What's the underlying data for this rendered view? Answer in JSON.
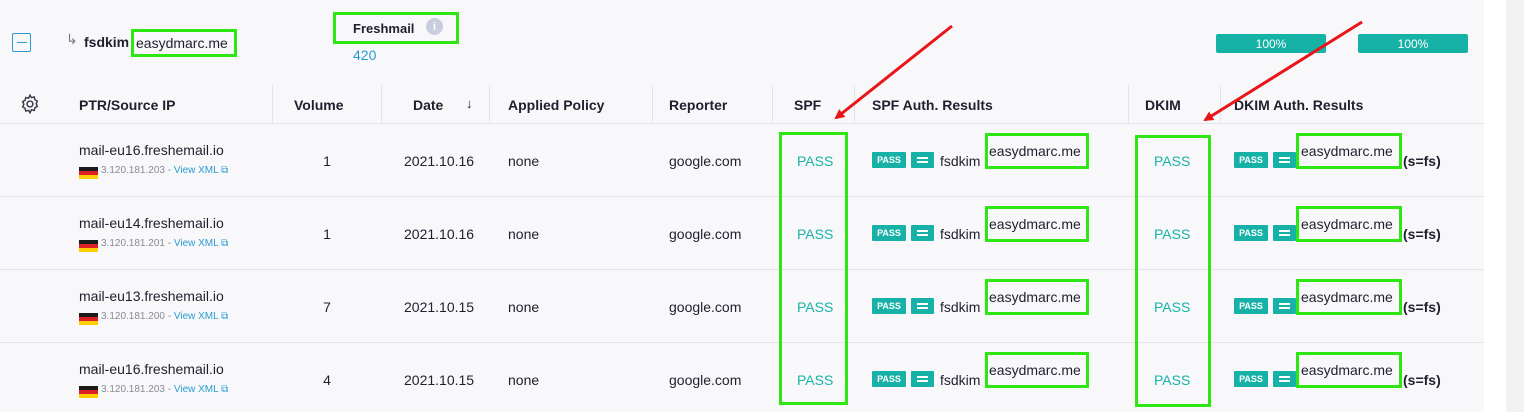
{
  "selector": {
    "prefix": "fsdkim",
    "domain": "easydmarc.me"
  },
  "provider": {
    "name": "Freshmail",
    "count": "420"
  },
  "percentages": [
    "100%",
    "100%"
  ],
  "columns": {
    "ptr": "PTR/Source IP",
    "volume": "Volume",
    "date": "Date",
    "policy": "Applied Policy",
    "reporter": "Reporter",
    "spf": "SPF",
    "spf_auth": "SPF Auth. Results",
    "dkim": "DKIM",
    "dkim_auth": "DKIM Auth. Results"
  },
  "rows": [
    {
      "host": "mail-eu16.freshemail.io",
      "ip": "3.120.181.203",
      "view_xml": "View XML",
      "volume": "1",
      "date": "2021.10.16",
      "policy": "none",
      "reporter": "google.com",
      "spf": "PASS",
      "spf_badge": "PASS",
      "spf_selector": "fsdkim",
      "spf_domain": "easydmarc.me",
      "dkim": "PASS",
      "dkim_badge": "PASS",
      "dkim_domain": "easydmarc.me",
      "dkim_selector": "(s=fs)"
    },
    {
      "host": "mail-eu14.freshemail.io",
      "ip": "3.120.181.201",
      "view_xml": "View XML",
      "volume": "1",
      "date": "2021.10.16",
      "policy": "none",
      "reporter": "google.com",
      "spf": "PASS",
      "spf_badge": "PASS",
      "spf_selector": "fsdkim",
      "spf_domain": "easydmarc.me",
      "dkim": "PASS",
      "dkim_badge": "PASS",
      "dkim_domain": "easydmarc.me",
      "dkim_selector": "(s=fs)"
    },
    {
      "host": "mail-eu13.freshemail.io",
      "ip": "3.120.181.200",
      "view_xml": "View XML",
      "volume": "7",
      "date": "2021.10.15",
      "policy": "none",
      "reporter": "google.com",
      "spf": "PASS",
      "spf_badge": "PASS",
      "spf_selector": "fsdkim",
      "spf_domain": "easydmarc.me",
      "dkim": "PASS",
      "dkim_badge": "PASS",
      "dkim_domain": "easydmarc.me",
      "dkim_selector": "(s=fs)"
    },
    {
      "host": "mail-eu16.freshemail.io",
      "ip": "3.120.181.203",
      "view_xml": "View XML",
      "volume": "4",
      "date": "2021.10.15",
      "policy": "none",
      "reporter": "google.com",
      "spf": "PASS",
      "spf_badge": "PASS",
      "spf_selector": "fsdkim",
      "spf_domain": "easydmarc.me",
      "dkim": "PASS",
      "dkim_badge": "PASS",
      "dkim_domain": "easydmarc.me",
      "dkim_selector": "(s=fs)"
    }
  ],
  "colors": {
    "accent": "#17b2a7",
    "link": "#2a9bd1",
    "highlight": "#2ee611",
    "annotation_arrow": "#e8161a"
  },
  "icons": {
    "collapse": "minus-square-icon",
    "settings": "gear-icon",
    "sort": "arrow-down-icon",
    "info": "info-icon",
    "external": "external-link-icon",
    "flag": "germany-flag-icon",
    "equals": "equals-icon"
  }
}
